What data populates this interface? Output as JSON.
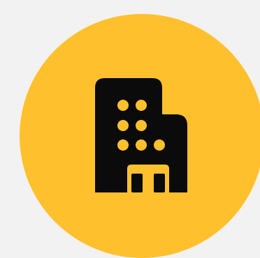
{
  "icon": {
    "name": "office-building-icon"
  },
  "colors": {
    "page_background": "#f2f2f2",
    "circle_fill": "#ffc02e",
    "icon_fill": "#0b0b0b",
    "window_dots": "#ffc02e"
  }
}
